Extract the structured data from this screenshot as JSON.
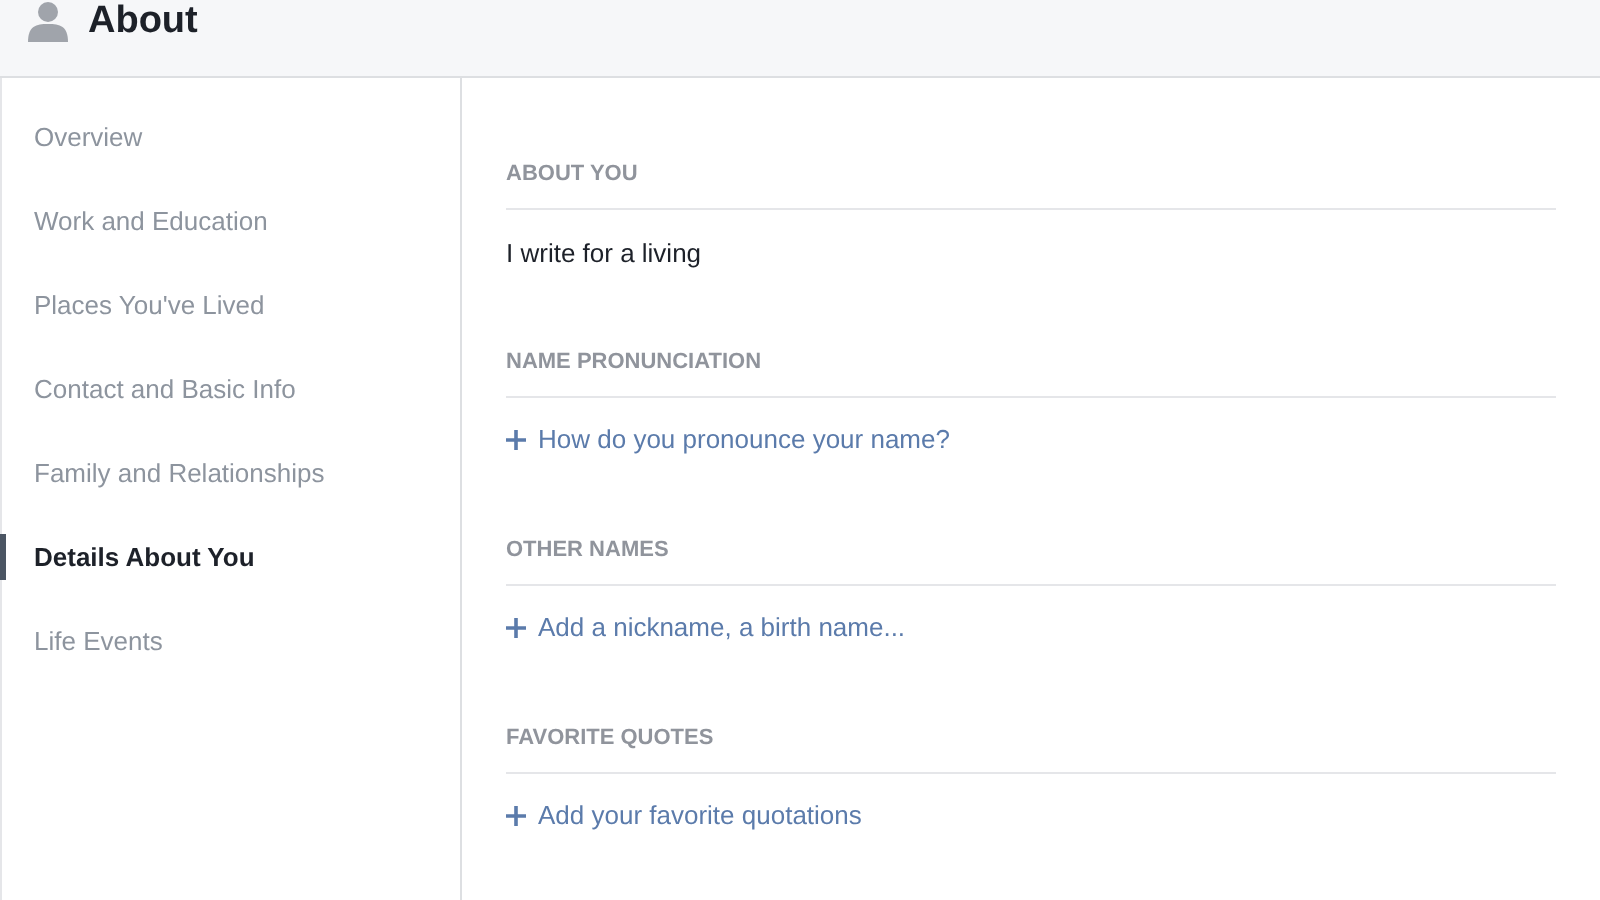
{
  "header": {
    "title": "About"
  },
  "sidebar": {
    "items": [
      {
        "label": "Overview",
        "selected": false
      },
      {
        "label": "Work and Education",
        "selected": false
      },
      {
        "label": "Places You've Lived",
        "selected": false
      },
      {
        "label": "Contact and Basic Info",
        "selected": false
      },
      {
        "label": "Family and Relationships",
        "selected": false
      },
      {
        "label": "Details About You",
        "selected": true
      },
      {
        "label": "Life Events",
        "selected": false
      }
    ]
  },
  "sections": [
    {
      "heading": "ABOUT YOU",
      "kind": "text",
      "text": "I write for a living"
    },
    {
      "heading": "NAME PRONUNCIATION",
      "kind": "add",
      "text": "How do you pronounce your name?"
    },
    {
      "heading": "OTHER NAMES",
      "kind": "add",
      "text": "Add a nickname, a birth name..."
    },
    {
      "heading": "FAVORITE QUOTES",
      "kind": "add",
      "text": "Add your favorite quotations"
    }
  ]
}
